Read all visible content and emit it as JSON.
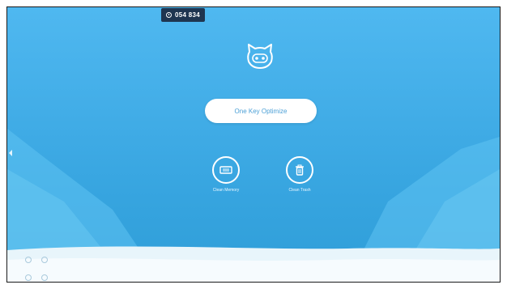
{
  "header": {
    "device_id": "054 834",
    "id_icon": "clock-icon"
  },
  "main": {
    "mascot_icon": "cat-robot-icon",
    "optimize_label": "One Key Optimize",
    "tools": [
      {
        "label": "Clean Memory",
        "icon": "memory-chip-icon"
      },
      {
        "label": "Clean Trash",
        "icon": "trash-icon"
      }
    ]
  },
  "footer": {
    "icons": [
      "circle-icon",
      "circle-icon"
    ]
  },
  "colors": {
    "sky_top": "#4fb8f0",
    "sky_bottom": "#2f9ed8",
    "badge": "#1f3550",
    "button_text": "#4a9fd6",
    "white": "#ffffff"
  }
}
